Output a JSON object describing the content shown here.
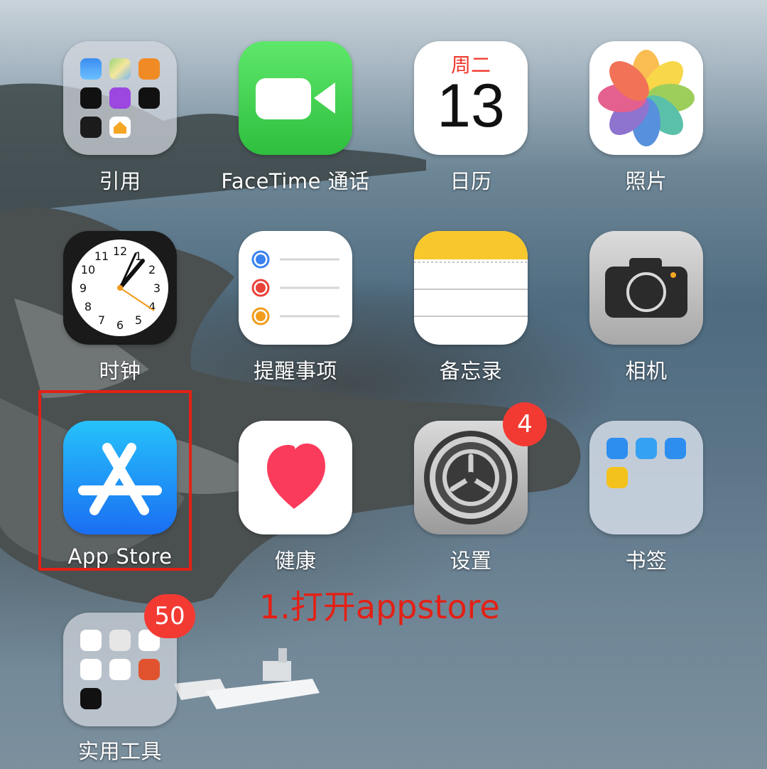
{
  "apps": {
    "folder_yinyong": {
      "label": "引用"
    },
    "facetime": {
      "label": "FaceTime 通话"
    },
    "calendar": {
      "label": "日历",
      "weekday": "周二",
      "day": "13"
    },
    "photos": {
      "label": "照片"
    },
    "clock": {
      "label": "时钟",
      "numerals": [
        "12",
        "1",
        "2",
        "3",
        "4",
        "5",
        "6",
        "7",
        "8",
        "9",
        "10",
        "11"
      ]
    },
    "reminders": {
      "label": "提醒事项"
    },
    "notes": {
      "label": "备忘录"
    },
    "camera": {
      "label": "相机"
    },
    "appstore": {
      "label": "App Store"
    },
    "health": {
      "label": "健康"
    },
    "settings": {
      "label": "设置",
      "badge": "4"
    },
    "folder_bookmarks": {
      "label": "书签"
    },
    "folder_tools": {
      "label": "实用工具",
      "badge": "50"
    }
  },
  "annotation": {
    "text": "1.打开appstore"
  },
  "colors": {
    "annotation": "#e42015",
    "badge": "#f23a33",
    "facetime_green": "#3ecf4e",
    "appstore_blue": "#1a8cf5"
  }
}
